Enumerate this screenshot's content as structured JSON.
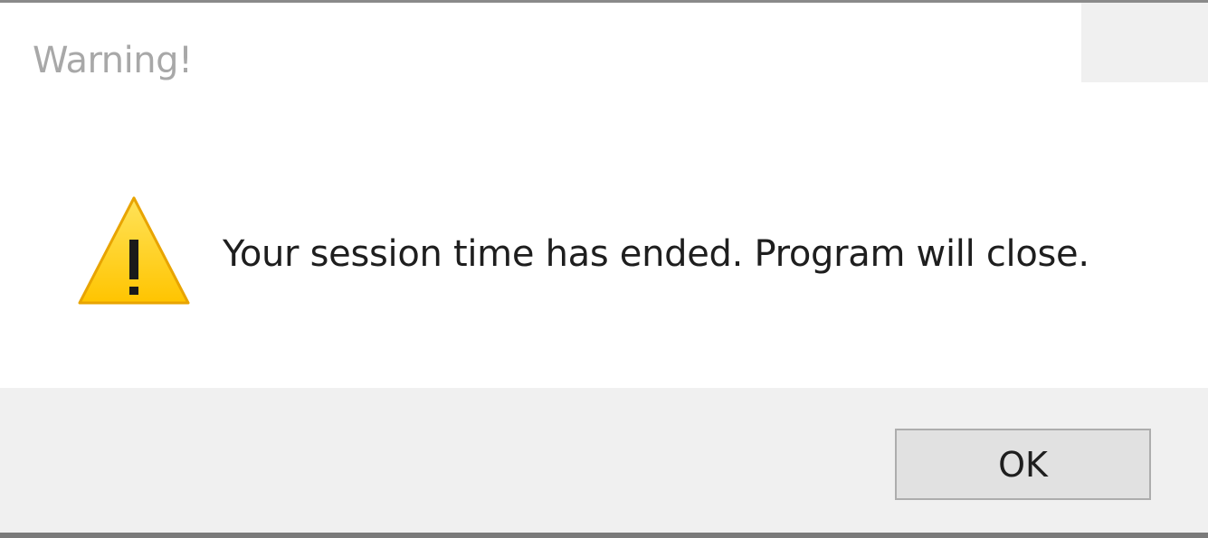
{
  "dialog": {
    "title": "Warning!",
    "icon": "warning-triangle-icon",
    "message": "Your session time has ended.  Program will close.",
    "ok_label": "OK"
  },
  "colors": {
    "icon_fill": "#ffd21f",
    "icon_stroke": "#e8a400",
    "icon_glyph": "#1a1a1a",
    "title_text": "#a8a8a8",
    "message_text": "#1e1e1e",
    "button_bar": "#f0f0f0",
    "button_face": "#e1e1e1",
    "button_border": "#adadad"
  }
}
